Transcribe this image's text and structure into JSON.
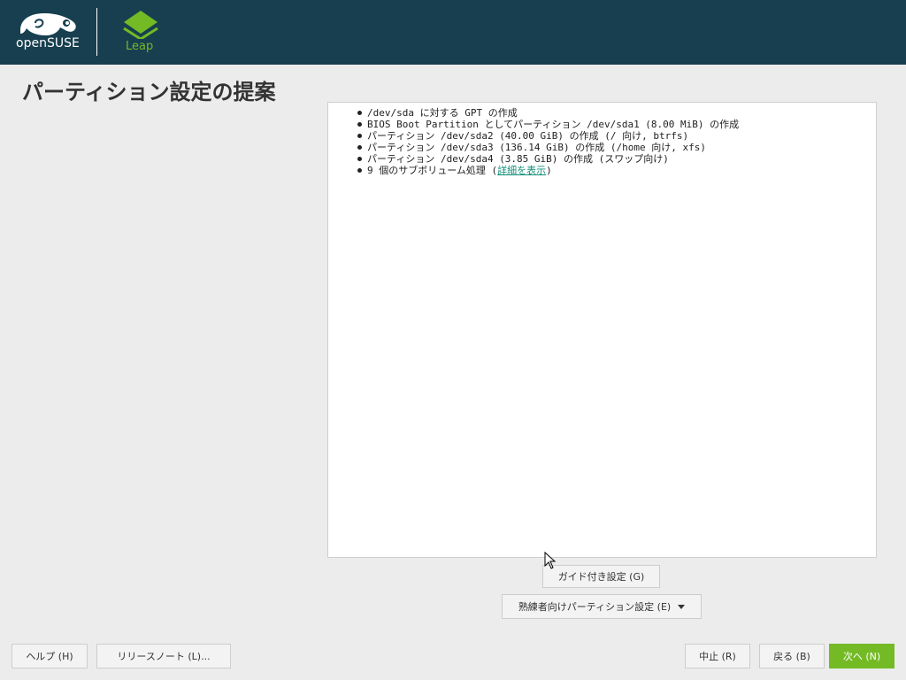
{
  "header": {
    "brand_logo_text": "openSUSE",
    "product_logo_text": "Leap",
    "brand_color": "#173f4f",
    "accent_color": "#73ba25"
  },
  "page": {
    "title": "パーティション設定の提案"
  },
  "summary": {
    "items": [
      "/dev/sda に対する GPT の作成",
      "BIOS Boot Partition としてパーティション /dev/sda1 (8.00 MiB) の作成",
      "パーティション /dev/sda2 (40.00 GiB) の作成 (/ 向け, btrfs)",
      "パーティション /dev/sda3 (136.14 GiB) の作成 (/home 向け, xfs)",
      "パーティション /dev/sda4 (3.85 GiB) の作成 (スワップ向け)"
    ],
    "last_item_prefix": "9 個のサブボリューム処理 (",
    "last_item_link": "詳細を表示",
    "last_item_suffix": ")"
  },
  "actions": {
    "guided_setup": "ガイド付き設定 (G)",
    "expert_partitioner": "熟練者向けパーティション設定 (E)"
  },
  "footer": {
    "help": "ヘルプ (H)",
    "release_notes": "リリースノート (L)...",
    "abort": "中止 (R)",
    "back": "戻る (B)",
    "next": "次へ (N)"
  }
}
